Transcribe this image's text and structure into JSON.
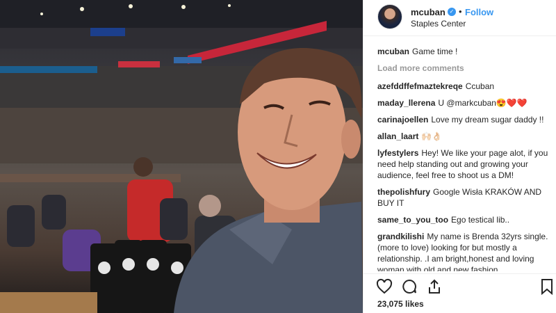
{
  "post": {
    "username": "mcuban",
    "verified_icon": "verified-badge-icon",
    "separator": "•",
    "follow_label": "Follow",
    "location": "Staples Center",
    "caption_user": "mcuban",
    "caption_text": "Game time !",
    "load_more": "Load more comments",
    "likes": "23,075 likes"
  },
  "comments": [
    {
      "user": "azefddffefmaztekreqe",
      "text": "Ccuban"
    },
    {
      "user": "maday_llerena",
      "text": "U @markcuban😍❤️❤️"
    },
    {
      "user": "carinajoellen",
      "text": "Love my dream sugar daddy !!"
    },
    {
      "user": "allan_laart",
      "text": "🙌🏻👌🏻"
    },
    {
      "user": "lyfestylers",
      "text": "Hey! We like your page alot, if you need help standing out and growing your audience, feel free to shoot us a DM!"
    },
    {
      "user": "thepolishfury",
      "text": "Google Wisła KRAKÓW AND BUY IT"
    },
    {
      "user": "same_to_you_too",
      "text": "Ego testical lib.."
    },
    {
      "user": "grandkilishi",
      "text": "My name is Brenda 32yrs single.(more to love) looking for but mostly a relationship. .I am bright,honest and loving woman with old and new fashion"
    }
  ],
  "icons": {
    "like": "heart-icon",
    "comment": "comment-icon",
    "share": "share-icon",
    "save": "bookmark-icon"
  },
  "colors": {
    "link": "#3897f0",
    "muted": "#999999",
    "text": "#262626"
  }
}
